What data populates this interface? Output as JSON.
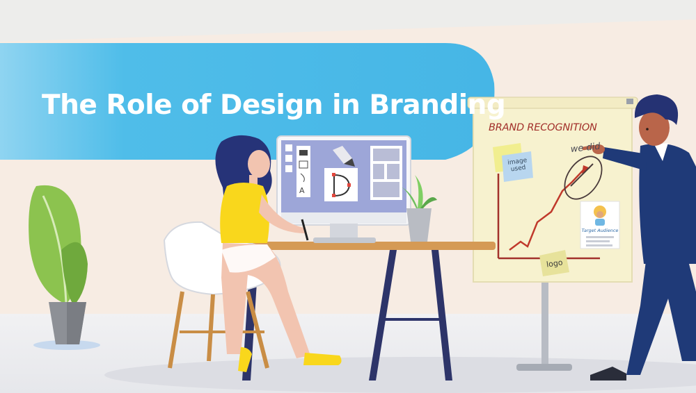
{
  "banner": {
    "title": "The Role of Design in Branding"
  },
  "flipchart": {
    "heading": "BRAND RECOGNITION",
    "handwriting": "we did",
    "sticky_note_image": "image\nused",
    "sticky_note_logo": "logo",
    "audience_card_label": "Target Audience"
  },
  "colors": {
    "banner_blue": "#4fbde9",
    "wall_peach": "#f7ece3",
    "shirt_yellow": "#f9d71c",
    "suit_navy": "#1f3a78",
    "accent_red": "#a2302b"
  }
}
